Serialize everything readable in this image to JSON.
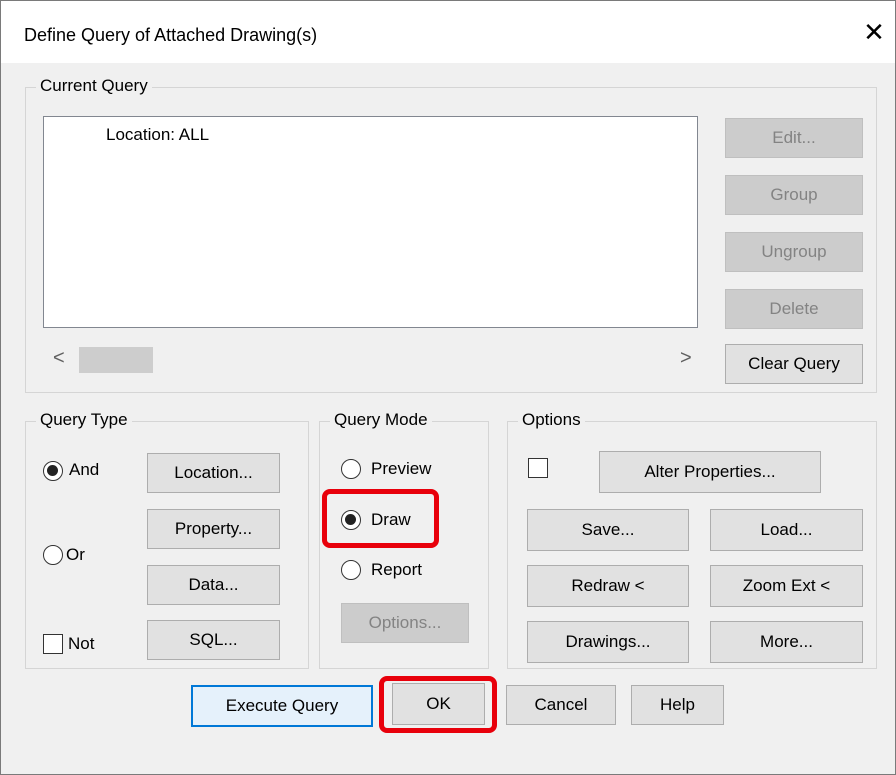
{
  "window": {
    "title": "Define Query of Attached Drawing(s)",
    "close_glyph": "✕"
  },
  "current_query": {
    "legend": "Current Query",
    "items": [
      "Location: ALL"
    ],
    "buttons": {
      "edit": "Edit...",
      "group": "Group",
      "ungroup": "Ungroup",
      "delete": "Delete",
      "clear": "Clear Query"
    },
    "scroll_left": "<",
    "scroll_right": ">"
  },
  "query_type": {
    "legend": "Query Type",
    "and_label": "And",
    "or_label": "Or",
    "not_label": "Not",
    "buttons": {
      "location": "Location...",
      "property": "Property...",
      "data": "Data...",
      "sql": "SQL..."
    }
  },
  "query_mode": {
    "legend": "Query Mode",
    "preview_label": "Preview",
    "draw_label": "Draw",
    "report_label": "Report",
    "options_button": "Options..."
  },
  "options": {
    "legend": "Options",
    "buttons": {
      "alter_properties": "Alter Properties...",
      "save": "Save...",
      "load": "Load...",
      "redraw": "Redraw <",
      "zoom_ext": "Zoom Ext <",
      "drawings": "Drawings...",
      "more": "More..."
    }
  },
  "footer": {
    "execute": "Execute Query",
    "ok": "OK",
    "cancel": "Cancel",
    "help": "Help"
  },
  "colors": {
    "highlight": "#e8000b",
    "default_button_border": "#0078d7"
  }
}
